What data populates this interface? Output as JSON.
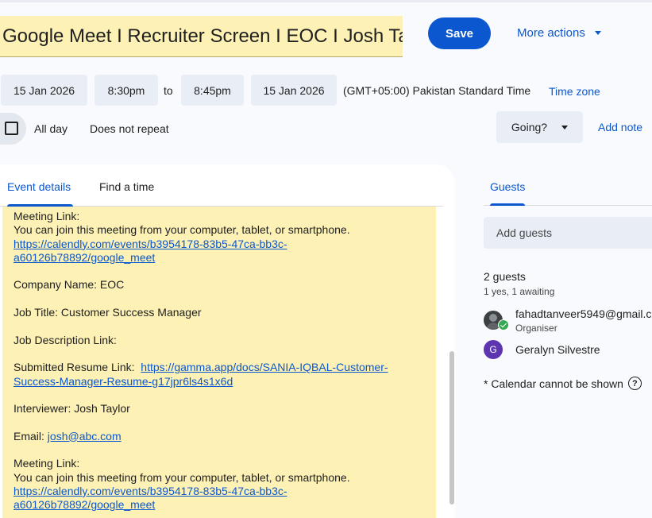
{
  "header": {
    "title": "Google Meet I Recruiter Screen I EOC I Josh Taylor",
    "save_label": "Save",
    "more_actions_label": "More actions"
  },
  "datetime": {
    "start_date": "15 Jan 2026",
    "start_time": "8:30pm",
    "to_label": "to",
    "end_time": "8:45pm",
    "end_date": "15 Jan 2026",
    "timezone_text": "(GMT+05:00) Pakistan Standard Time",
    "timezone_link": "Time zone",
    "all_day_label": "All day",
    "repeat_label": "Does not repeat",
    "going_label": "Going?",
    "add_note_label": "Add note"
  },
  "tabs": {
    "event_details": "Event details",
    "find_a_time": "Find a time"
  },
  "description": {
    "meeting_link_label_1": "Meeting Link:",
    "join_text_1": "You can join this meeting from your computer, tablet, or smartphone.",
    "calendly_url_1a": "https://calendly.com/events/b3954178-83b5-47ca-bb3c-",
    "calendly_url_1b": "a60126b78892/google_meet",
    "company": "Company Name: EOC",
    "job_title": "Job Title: Customer Success Manager",
    "job_desc": "Job Description Link:",
    "resume_label": "Submitted Resume Link:  ",
    "resume_url_a": "https://gamma.app/docs/SANIA-IQBAL-Customer-",
    "resume_url_b": "Success-Manager-Resume-g17jpr6ls4s1x6d",
    "interviewer": "Interviewer: Josh Taylor",
    "email_label": "Email: ",
    "email": "josh@abc.com",
    "meeting_link_label_2": "Meeting Link:",
    "join_text_2": "You can join this meeting from your computer, tablet, or smartphone.",
    "calendly_url_2a": "https://calendly.com/events/b3954178-83b5-47ca-bb3c-",
    "calendly_url_2b": "a60126b78892/google_meet"
  },
  "guests": {
    "tab_label": "Guests",
    "add_placeholder": "Add guests",
    "count": "2 guests",
    "summary": "1 yes, 1 awaiting",
    "list": [
      {
        "name": "fahadtanveer5949@gmail.com",
        "role": "Organiser",
        "avatar": "photo"
      },
      {
        "name": "Geralyn Silvestre",
        "initial": "G",
        "avatar_color": "#5e35b1"
      }
    ],
    "calendar_note": "* Calendar cannot be shown",
    "help_glyph": "?"
  },
  "colors": {
    "accent": "#0b57d0",
    "event_yellow": "#fdf1b5",
    "chip_bg": "#e9eef6",
    "accepted_green": "#34a853"
  }
}
